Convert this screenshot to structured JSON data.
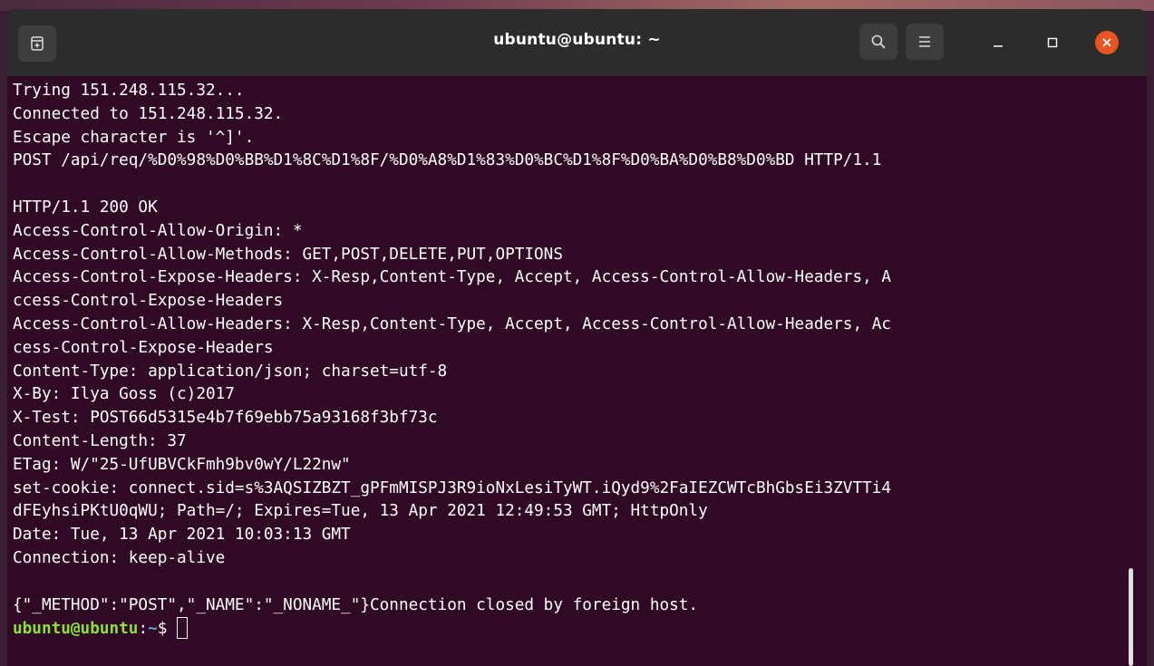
{
  "window": {
    "title": "ubuntu@ubuntu: ~"
  },
  "titlebar": {
    "new_tab_icon": "new-tab-icon",
    "search_icon": "search-icon",
    "menu_icon": "hamburger-menu-icon",
    "minimize_icon": "minimize-icon",
    "maximize_icon": "maximize-icon",
    "close_icon": "close-icon"
  },
  "colors": {
    "terminal_background": "#300a24",
    "titlebar_background": "#2c2c2c",
    "close_button": "#e95420",
    "prompt_user": "#8ae234",
    "prompt_path": "#729fcf",
    "text": "#ffffff"
  },
  "terminal": {
    "lines": [
      "Trying 151.248.115.32...",
      "Connected to 151.248.115.32.",
      "Escape character is '^]'.",
      "POST /api/req/%D0%98%D0%BB%D1%8C%D1%8F/%D0%A8%D1%83%D0%BC%D1%8F%D0%BA%D0%B8%D0%BD HTTP/1.1",
      "",
      "HTTP/1.1 200 OK",
      "Access-Control-Allow-Origin: *",
      "Access-Control-Allow-Methods: GET,POST,DELETE,PUT,OPTIONS",
      "Access-Control-Expose-Headers: X-Resp,Content-Type, Accept, Access-Control-Allow-Headers, A",
      "ccess-Control-Expose-Headers",
      "Access-Control-Allow-Headers: X-Resp,Content-Type, Accept, Access-Control-Allow-Headers, Ac",
      "cess-Control-Expose-Headers",
      "Content-Type: application/json; charset=utf-8",
      "X-By: Ilya Goss (c)2017",
      "X-Test: POST66d5315e4b7f69ebb75a93168f3bf73c",
      "Content-Length: 37",
      "ETag: W/\"25-UfUBVCkFmh9bv0wY/L22nw\"",
      "set-cookie: connect.sid=s%3AQSIZBZT_gPFmMISPJ3R9ioNxLesiTyWT.iQyd9%2FaIEZCWTcBhGbsEi3ZVTTi4",
      "dFEyhsiPKtU0qWU; Path=/; Expires=Tue, 13 Apr 2021 12:49:53 GMT; HttpOnly",
      "Date: Tue, 13 Apr 2021 10:03:13 GMT",
      "Connection: keep-alive",
      "",
      "{\"_METHOD\":\"POST\",\"_NAME\":\"_NONAME_\"}Connection closed by foreign host."
    ],
    "prompt": {
      "user_host": "ubuntu@ubuntu",
      "separator": ":",
      "path": "~",
      "symbol": "$ "
    }
  }
}
